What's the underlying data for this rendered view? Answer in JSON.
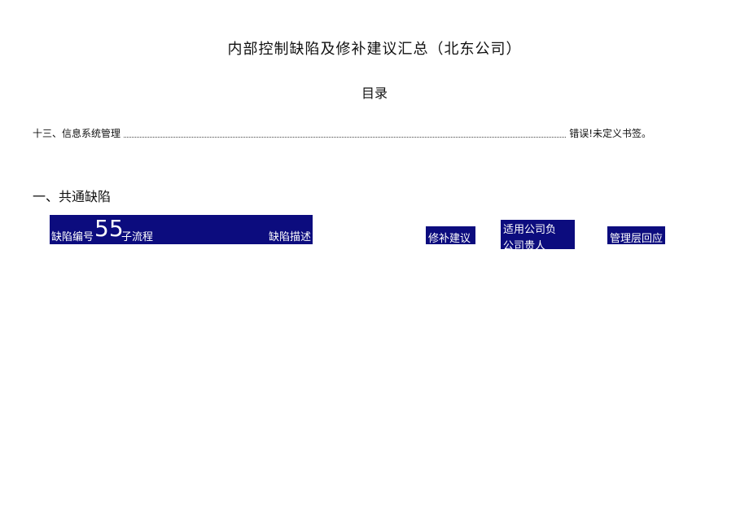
{
  "document": {
    "title": "内部控制缺陷及修补建议汇总（北东公司）",
    "toc_heading": "目录",
    "toc_entries": [
      {
        "label": "十三、信息系统管理",
        "reference": "错误!未定义书签。"
      }
    ],
    "section_heading": "一、共通缺陷"
  },
  "table_header": {
    "defect_id_label": "缺陷编号",
    "big_number": "55",
    "subprocess_label": "子流程",
    "defect_description_label": "缺陷描述",
    "remediation_label": "修补建议",
    "applicable_company_line1": "适用公司负",
    "applicable_company_line2": "公司贵人",
    "management_response_label": "管理层回应"
  },
  "colors": {
    "header_bg": "#0c0c7e",
    "header_text": "#ffffff"
  }
}
